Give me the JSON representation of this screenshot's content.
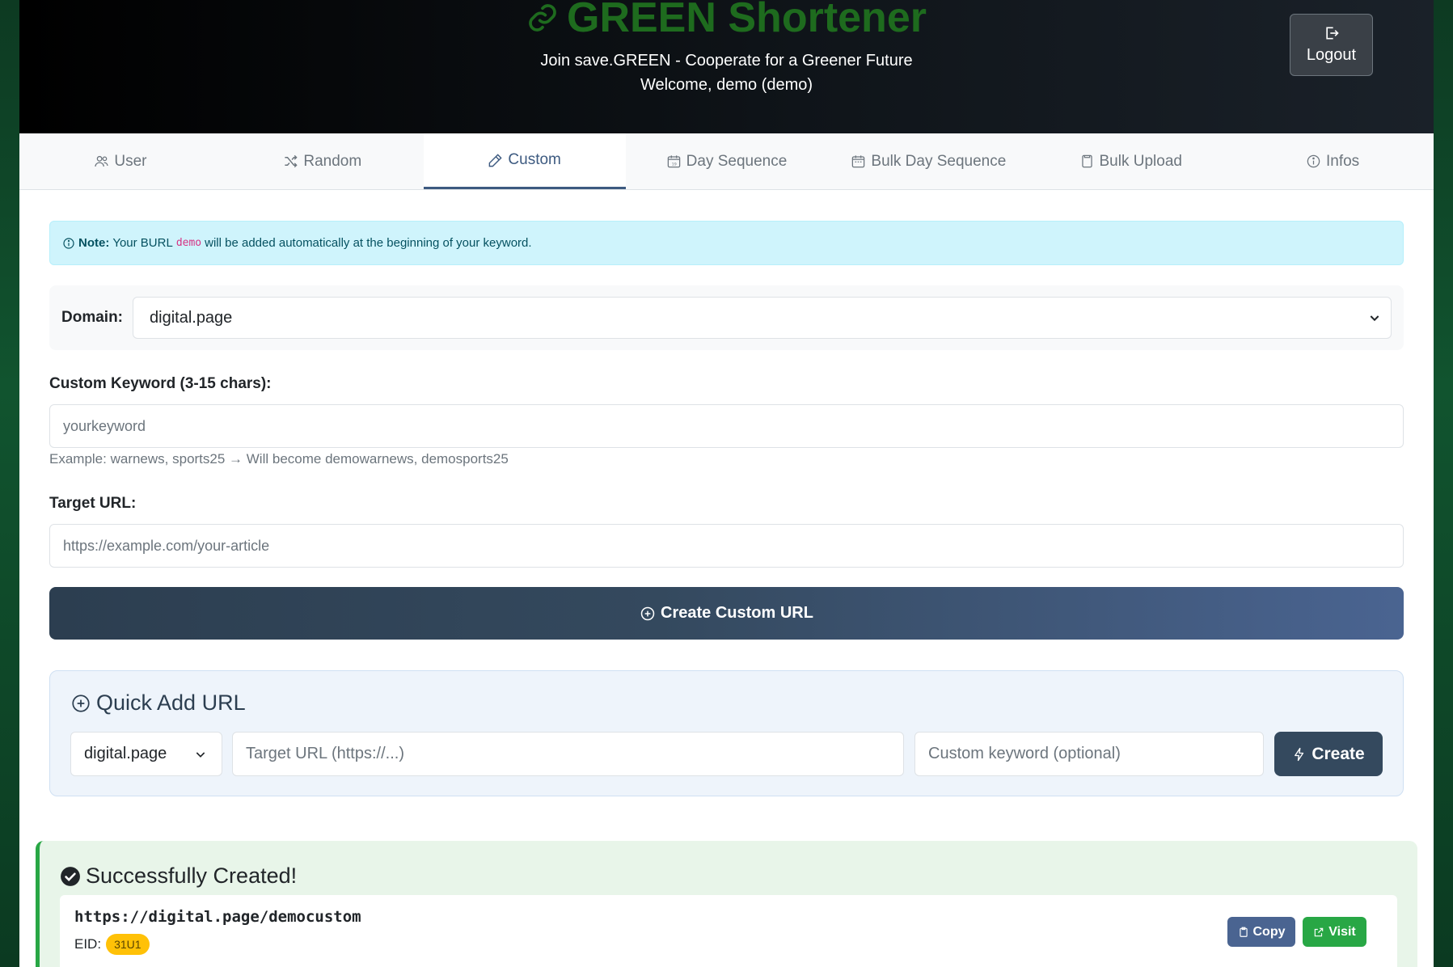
{
  "header": {
    "title": "GREEN Shortener",
    "subtitle": "Join save.GREEN - Cooperate for a Greener Future",
    "welcome": "Welcome, demo (demo)",
    "logout_label": "Logout"
  },
  "tabs": [
    {
      "label": "User",
      "icon": "users-icon"
    },
    {
      "label": "Random",
      "icon": "shuffle-icon"
    },
    {
      "label": "Custom",
      "icon": "pencil-icon",
      "active": true
    },
    {
      "label": "Day Sequence",
      "icon": "calendar-icon"
    },
    {
      "label": "Bulk Day Sequence",
      "icon": "calendar-week-icon"
    },
    {
      "label": "Bulk Upload",
      "icon": "file-icon"
    },
    {
      "label": "Infos",
      "icon": "info-icon"
    }
  ],
  "note": {
    "prefix": "Note:",
    "text_before": "Your BURL",
    "code": "demo",
    "text_after": "will be added automatically at the beginning of your keyword."
  },
  "domain": {
    "label": "Domain:",
    "selected": "digital.page"
  },
  "keyword": {
    "label": "Custom Keyword (3-15 chars):",
    "placeholder": "yourkeyword",
    "help": "Example: warnews, sports25 → Will become demowarnews, demosports25"
  },
  "target": {
    "label": "Target URL:",
    "placeholder": "https://example.com/your-article"
  },
  "create_button": "Create Custom URL",
  "quick_add": {
    "title": "Quick Add URL",
    "domain_selected": "digital.page",
    "target_placeholder": "Target URL (https://...)",
    "keyword_placeholder": "Custom keyword (optional)",
    "button": "Create"
  },
  "success": {
    "title": "Successfully Created!",
    "url": "https://digital.page/democustom",
    "eid_label": "EID:",
    "eid_value": "31U1",
    "copy_label": "Copy",
    "visit_label": "Visit"
  },
  "colors": {
    "brand_green": "#1e6b1e",
    "accent": "#3d5a80",
    "success": "#28a745",
    "badge": "#ffc107"
  }
}
